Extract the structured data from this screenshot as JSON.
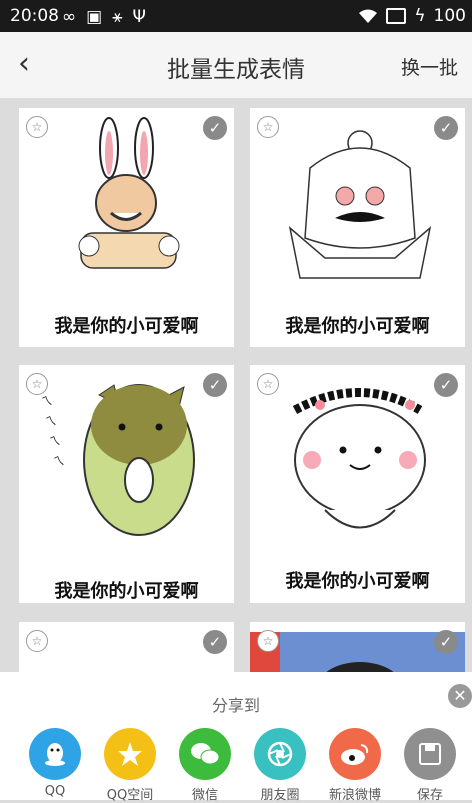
{
  "status": {
    "time": "20:08",
    "battery": "100"
  },
  "header": {
    "title": "批量生成表情",
    "refresh_label": "换一批",
    "back_glyph": "‹"
  },
  "grid": {
    "cards": [
      {
        "caption": "我是你的小可爱啊",
        "image": "bunny-ears-meme-face"
      },
      {
        "caption": "我是你的小可爱啊",
        "image": "anime-girl-mustache"
      },
      {
        "caption": "我是你的小可爱啊",
        "image": "green-hamster"
      },
      {
        "caption": "我是你的小可爱啊",
        "image": "blob-kid-curly-hair"
      }
    ]
  },
  "share": {
    "title": "分享到",
    "items": [
      {
        "label": "QQ",
        "icon": "qq-icon",
        "color": "#2ea4e6"
      },
      {
        "label": "QQ空间",
        "icon": "qzone-icon",
        "color": "#f5c015"
      },
      {
        "label": "微信",
        "icon": "wechat-icon",
        "color": "#3cbb3c"
      },
      {
        "label": "朋友圈",
        "icon": "moments-icon",
        "color": "#39c0c0"
      },
      {
        "label": "新浪微博",
        "icon": "weibo-icon",
        "color": "#f06a4a"
      },
      {
        "label": "保存",
        "icon": "save-icon",
        "color": "#8f8f8f"
      }
    ]
  }
}
